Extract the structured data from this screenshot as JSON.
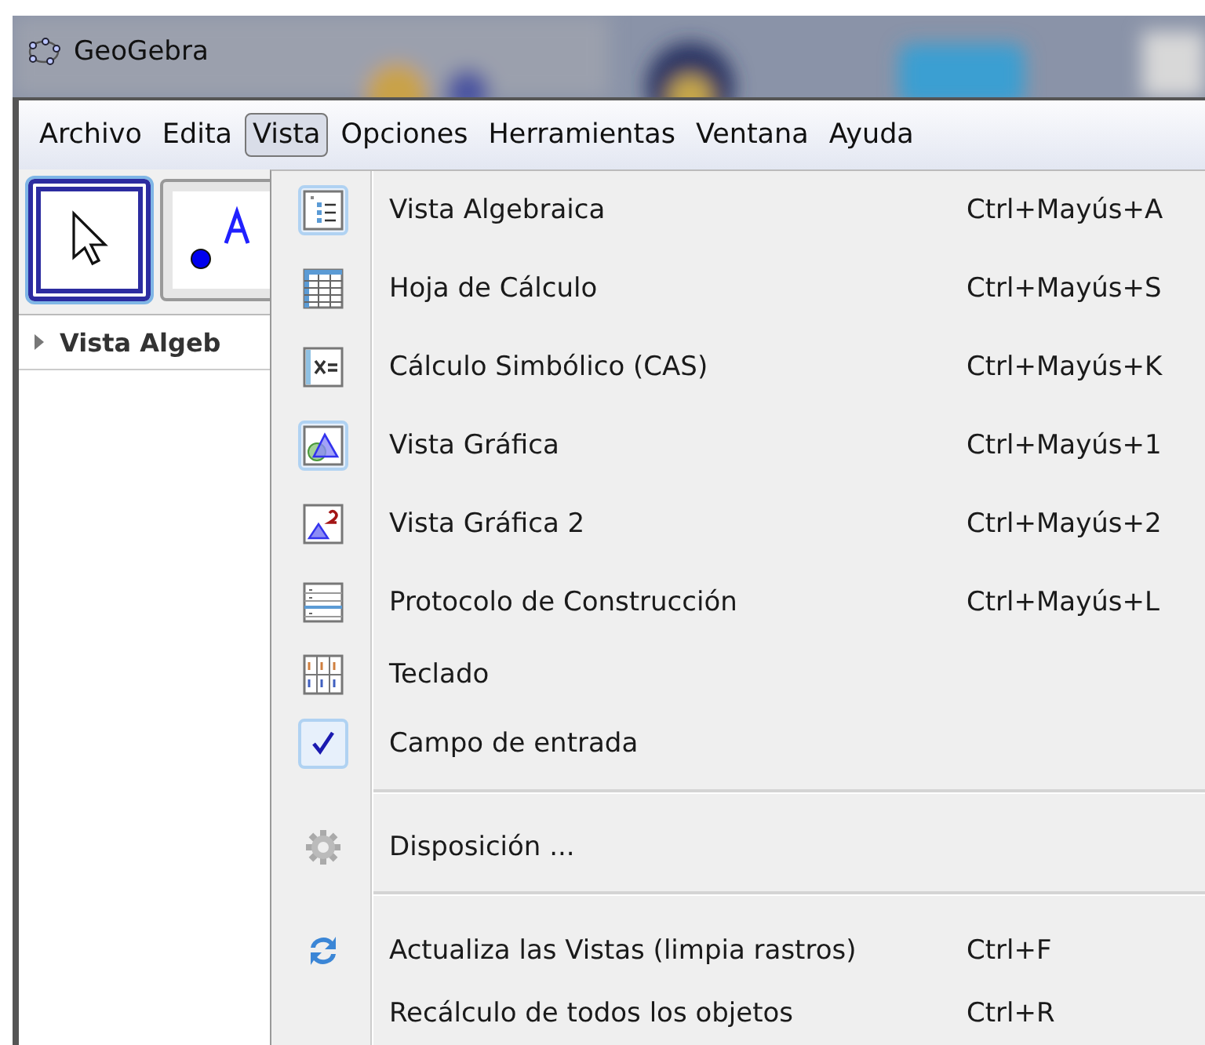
{
  "window": {
    "title": "GeoGebra"
  },
  "menu_bar": [
    {
      "label": "Archivo",
      "selected": false
    },
    {
      "label": "Edita",
      "selected": false
    },
    {
      "label": "Vista",
      "selected": true
    },
    {
      "label": "Opciones",
      "selected": false
    },
    {
      "label": "Herramientas",
      "selected": false
    },
    {
      "label": "Ventana",
      "selected": false
    },
    {
      "label": "Ayuda",
      "selected": false
    }
  ],
  "toolbar": {
    "tools": [
      {
        "selected": true
      },
      {
        "selected": false
      }
    ]
  },
  "panel": {
    "header": "Vista Algeb"
  },
  "view_menu": {
    "sections": [
      {
        "items": [
          {
            "kind": "view",
            "label": "Vista Algebraica",
            "shortcut": "Ctrl+Mayús+A",
            "checked": true
          },
          {
            "kind": "view",
            "label": "Hoja de Cálculo",
            "shortcut": "Ctrl+Mayús+S",
            "checked": false
          },
          {
            "kind": "view",
            "label": "Cálculo Simbólico (CAS)",
            "shortcut": "Ctrl+Mayús+K",
            "checked": false
          },
          {
            "kind": "view",
            "label": "Vista Gráfica",
            "shortcut": "Ctrl+Mayús+1",
            "checked": true
          },
          {
            "kind": "view",
            "label": "Vista Gráfica 2",
            "shortcut": "Ctrl+Mayús+2",
            "checked": false
          },
          {
            "kind": "view",
            "label": "Protocolo de Construcción",
            "shortcut": "Ctrl+Mayús+L",
            "checked": false
          },
          {
            "kind": "view",
            "label": "Teclado",
            "checked": false
          },
          {
            "kind": "check",
            "label": "Campo de entrada",
            "checked": true
          }
        ]
      },
      {
        "items": [
          {
            "kind": "command",
            "label": "Disposición ..."
          }
        ]
      },
      {
        "items": [
          {
            "kind": "command",
            "label": "Actualiza las Vistas (limpia rastros)",
            "shortcut": "Ctrl+F"
          },
          {
            "kind": "command",
            "label": "Recálculo de todos los objetos",
            "shortcut": "Ctrl+R"
          }
        ]
      }
    ]
  }
}
